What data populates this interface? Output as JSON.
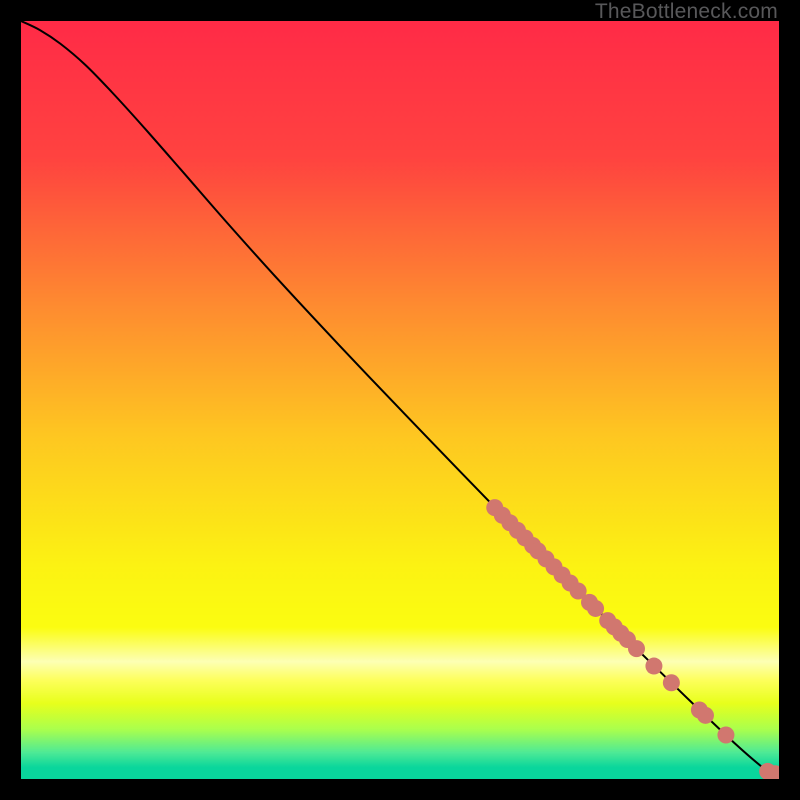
{
  "watermark": "TheBottleneck.com",
  "colors": {
    "dot": "#d1776f",
    "curve": "#000000"
  },
  "chart_data": {
    "type": "line",
    "title": "",
    "xlabel": "",
    "ylabel": "",
    "xlim": [
      0,
      100
    ],
    "ylim": [
      0,
      100
    ],
    "grid": false,
    "gradient_stops": [
      {
        "offset": 0.0,
        "color": "#ff2b47"
      },
      {
        "offset": 0.18,
        "color": "#ff4340"
      },
      {
        "offset": 0.38,
        "color": "#fe8d30"
      },
      {
        "offset": 0.55,
        "color": "#fec821"
      },
      {
        "offset": 0.72,
        "color": "#fcf313"
      },
      {
        "offset": 0.8,
        "color": "#fbfd11"
      },
      {
        "offset": 0.845,
        "color": "#fdffb5"
      },
      {
        "offset": 0.87,
        "color": "#fdff5b"
      },
      {
        "offset": 0.9,
        "color": "#e8ff1c"
      },
      {
        "offset": 0.935,
        "color": "#a9ff4e"
      },
      {
        "offset": 0.965,
        "color": "#4eea96"
      },
      {
        "offset": 0.985,
        "color": "#09d69c"
      },
      {
        "offset": 1.0,
        "color": "#09d69c"
      }
    ],
    "curve_points": [
      {
        "x": 0.0,
        "y": 100.0
      },
      {
        "x": 2.5,
        "y": 98.8
      },
      {
        "x": 5.2,
        "y": 97.0
      },
      {
        "x": 8.5,
        "y": 94.2
      },
      {
        "x": 12.0,
        "y": 90.6
      },
      {
        "x": 16.0,
        "y": 86.2
      },
      {
        "x": 21.0,
        "y": 80.5
      },
      {
        "x": 27.0,
        "y": 73.6
      },
      {
        "x": 34.0,
        "y": 65.8
      },
      {
        "x": 42.0,
        "y": 57.2
      },
      {
        "x": 50.0,
        "y": 48.8
      },
      {
        "x": 58.0,
        "y": 40.5
      },
      {
        "x": 66.0,
        "y": 32.3
      },
      {
        "x": 74.0,
        "y": 24.3
      },
      {
        "x": 82.0,
        "y": 16.4
      },
      {
        "x": 89.0,
        "y": 9.6
      },
      {
        "x": 94.5,
        "y": 4.4
      },
      {
        "x": 98.0,
        "y": 1.4
      },
      {
        "x": 99.2,
        "y": 0.7
      },
      {
        "x": 100.0,
        "y": 0.6
      }
    ],
    "dot_clusters": [
      {
        "x_start": 62.5,
        "x_end": 67.5,
        "y_start": 35.8,
        "y_end": 30.8,
        "count": 6
      },
      {
        "x_start": 68.2,
        "x_end": 73.5,
        "y_start": 30.1,
        "y_end": 24.8,
        "count": 6
      },
      {
        "x_start": 75.0,
        "x_end": 75.8,
        "y_start": 23.3,
        "y_end": 22.5,
        "count": 2
      },
      {
        "x_start": 77.4,
        "x_end": 80.0,
        "y_start": 20.9,
        "y_end": 18.4,
        "count": 4
      },
      {
        "x_start": 81.2,
        "x_end": 81.2,
        "y_start": 17.2,
        "y_end": 17.2,
        "count": 1
      },
      {
        "x_start": 83.5,
        "x_end": 83.5,
        "y_start": 14.9,
        "y_end": 14.9,
        "count": 1
      },
      {
        "x_start": 85.8,
        "x_end": 85.8,
        "y_start": 12.7,
        "y_end": 12.7,
        "count": 1
      },
      {
        "x_start": 89.5,
        "x_end": 90.3,
        "y_start": 9.1,
        "y_end": 8.4,
        "count": 2
      },
      {
        "x_start": 93.0,
        "x_end": 93.0,
        "y_start": 5.8,
        "y_end": 5.8,
        "count": 1
      },
      {
        "x_start": 98.5,
        "x_end": 99.5,
        "y_start": 1.0,
        "y_end": 0.7,
        "count": 2
      }
    ]
  }
}
